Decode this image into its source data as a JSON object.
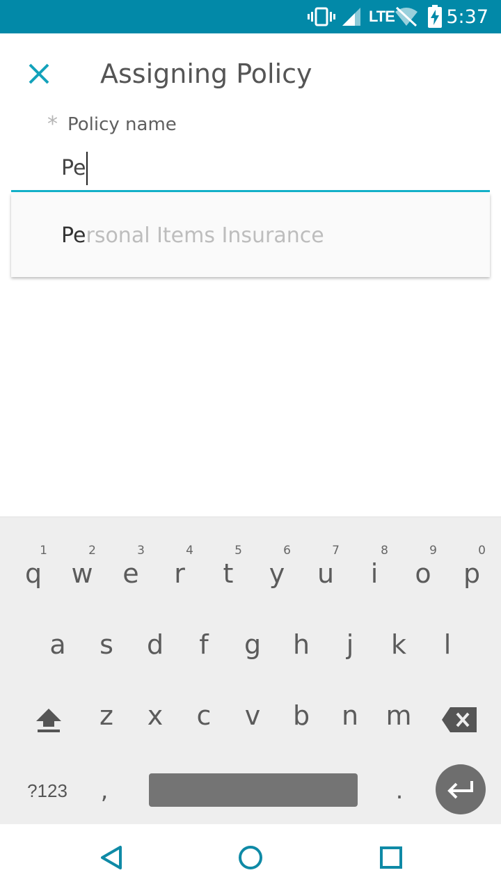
{
  "status_bar": {
    "time": "5:37",
    "network": "LTE",
    "icons": [
      "vibrate-icon",
      "signal-icon",
      "wifi-off-icon",
      "battery-charging-icon"
    ],
    "background": "#0289a8"
  },
  "header": {
    "title": "Assigning Policy",
    "close_icon": "close-icon",
    "accent": "#13b0c8"
  },
  "form": {
    "field_label": "Policy name",
    "required_marker": "*",
    "input_value": "Pe"
  },
  "suggestions": [
    {
      "match": "Pe",
      "rest": "rsonal Items Insurance"
    }
  ],
  "keyboard": {
    "row1": [
      {
        "key": "q",
        "hint": "1"
      },
      {
        "key": "w",
        "hint": "2"
      },
      {
        "key": "e",
        "hint": "3"
      },
      {
        "key": "r",
        "hint": "4"
      },
      {
        "key": "t",
        "hint": "5"
      },
      {
        "key": "y",
        "hint": "6"
      },
      {
        "key": "u",
        "hint": "7"
      },
      {
        "key": "i",
        "hint": "8"
      },
      {
        "key": "o",
        "hint": "9"
      },
      {
        "key": "p",
        "hint": "0"
      }
    ],
    "row2": [
      "a",
      "s",
      "d",
      "f",
      "g",
      "h",
      "j",
      "k",
      "l"
    ],
    "row3": [
      "z",
      "x",
      "c",
      "v",
      "b",
      "n",
      "m"
    ],
    "symbols_label": "?123",
    "comma": ",",
    "period": ".",
    "icons": [
      "shift-icon",
      "backspace-icon",
      "enter-icon"
    ]
  },
  "navbar": {
    "icons": [
      "back-icon",
      "home-icon",
      "recents-icon"
    ],
    "color": "#0f8aa6"
  }
}
